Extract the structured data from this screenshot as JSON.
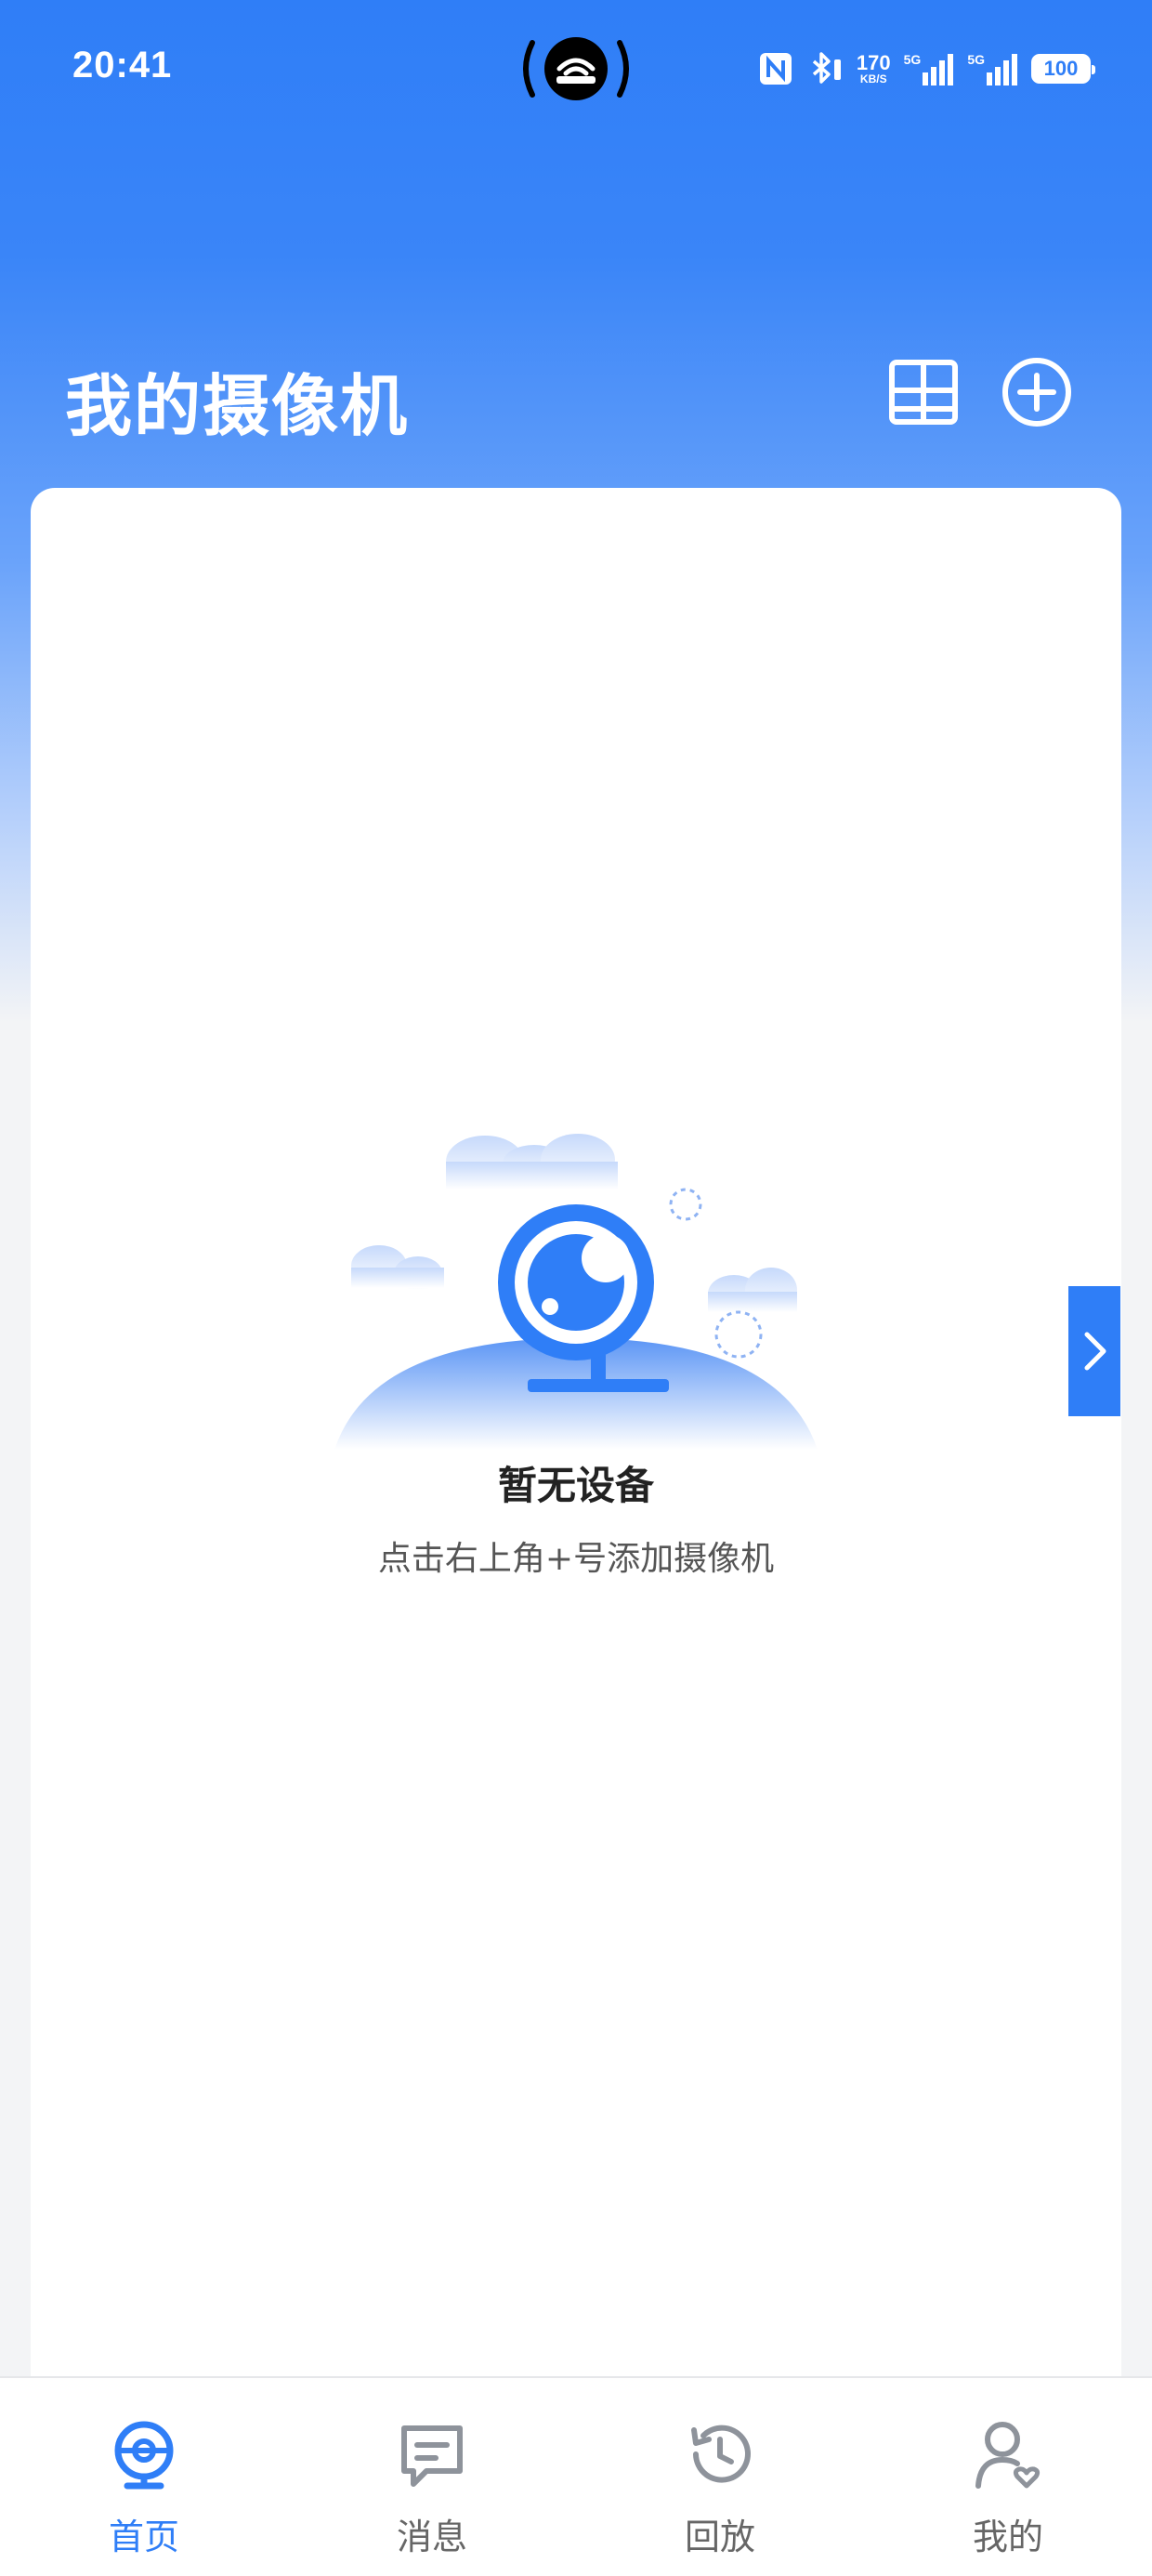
{
  "status_bar": {
    "time": "20:41",
    "net_speed_value": "170",
    "net_speed_unit": "KB/S",
    "signal_1_label": "5G",
    "signal_2_label": "5G",
    "battery_level": "100",
    "icons": [
      "nfc-icon",
      "bluetooth-icon",
      "signal-icon",
      "signal-icon",
      "battery-icon"
    ]
  },
  "header": {
    "title": "我的摄像机",
    "grid_view_icon": "grid-layout-icon",
    "add_icon": "add-circle-icon"
  },
  "empty_state": {
    "title": "暂无设备",
    "hint": "点击右上角+号添加摄像机",
    "illustration_icon": "camera-illustration-icon"
  },
  "side_tab": {
    "icon": "chevron-right-icon"
  },
  "bottom_nav": {
    "items": [
      {
        "label": "首页",
        "icon": "camera-home-icon",
        "active": true
      },
      {
        "label": "消息",
        "icon": "message-icon",
        "active": false
      },
      {
        "label": "回放",
        "icon": "history-icon",
        "active": false
      },
      {
        "label": "我的",
        "icon": "user-icon",
        "active": false
      }
    ]
  },
  "colors": {
    "accent": "#2f7ef7",
    "background": "#f3f4f6",
    "card": "#ffffff",
    "inactive": "#666666"
  }
}
